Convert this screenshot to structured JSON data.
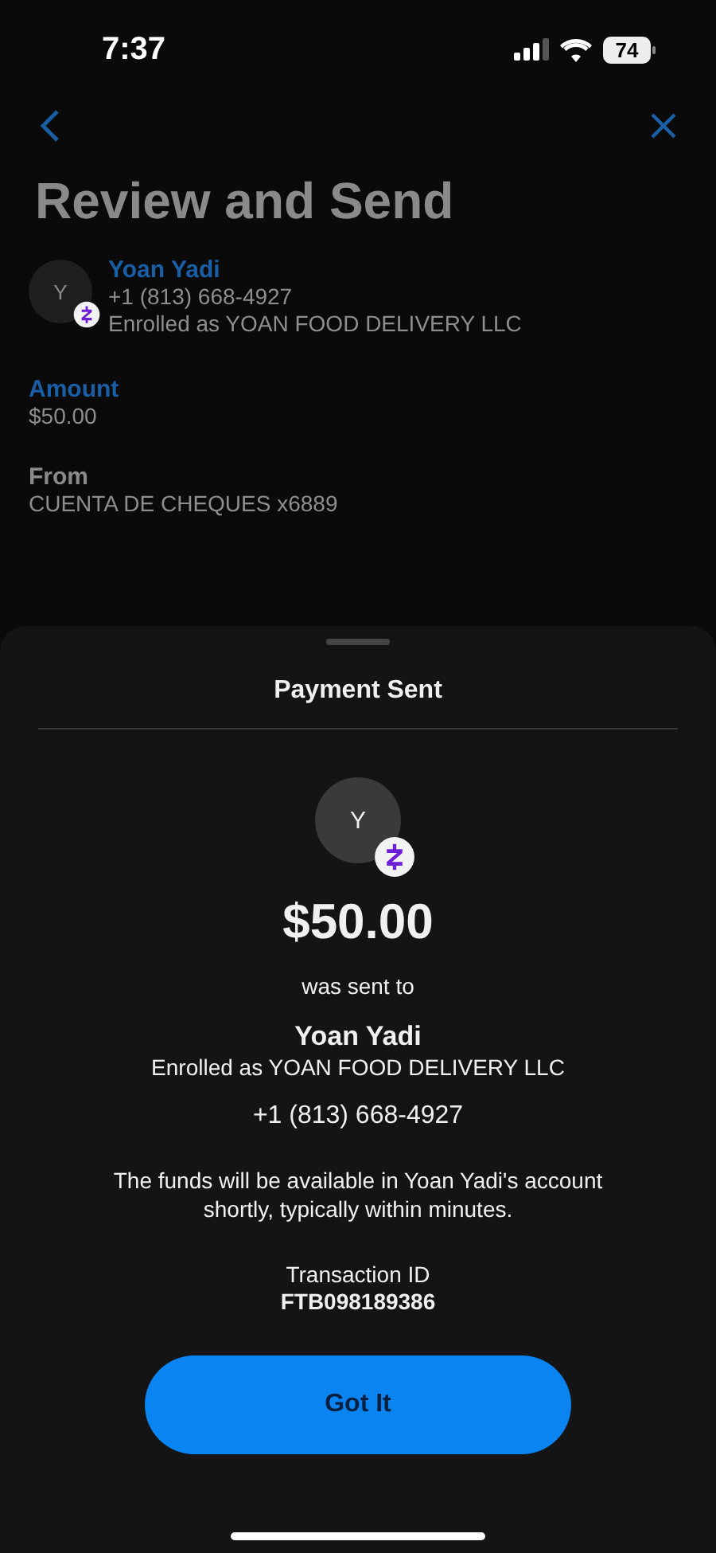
{
  "status_bar": {
    "time": "7:37",
    "battery": "74"
  },
  "review": {
    "title": "Review and Send",
    "recipient": {
      "initial": "Y",
      "name": "Yoan Yadi",
      "phone": "+1 (813) 668-4927",
      "enrolled": "Enrolled as YOAN FOOD DELIVERY LLC"
    },
    "fields": [
      {
        "label": "Amount",
        "value": "$50.00",
        "kind": "accent"
      },
      {
        "label": "From",
        "value": "CUENTA DE CHEQUES x6889",
        "kind": "plain"
      }
    ]
  },
  "sheet": {
    "title": "Payment Sent",
    "initial": "Y",
    "amount": "$50.00",
    "sent_to": "was sent to",
    "name": "Yoan Yadi",
    "enrolled": "Enrolled as YOAN FOOD DELIVERY LLC",
    "phone": "+1 (813) 668-4927",
    "note": "The funds will be available in Yoan Yadi's account shortly, typically within minutes.",
    "transaction_label": "Transaction ID",
    "transaction_id": "FTB098189386",
    "button": "Got It"
  }
}
